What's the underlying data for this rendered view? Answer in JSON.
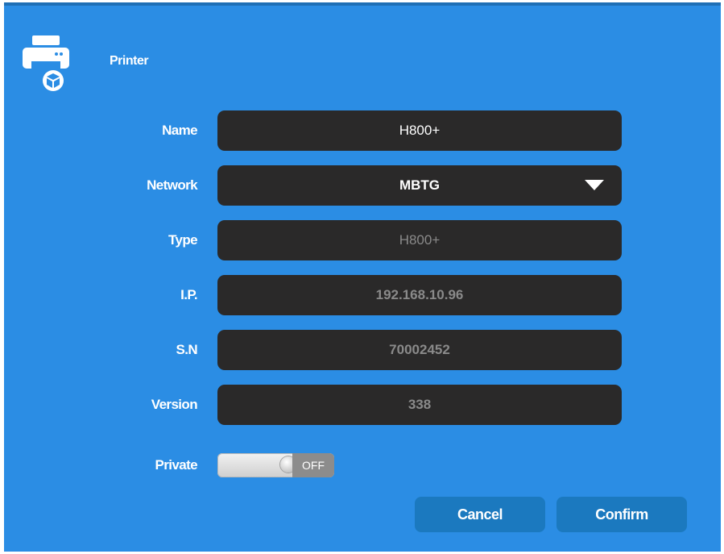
{
  "header": {
    "title": "Printer",
    "icon": "printer-icon"
  },
  "fields": {
    "name": {
      "label": "Name",
      "value": "H800+"
    },
    "network": {
      "label": "Network",
      "value": "MBTG",
      "icon": "dropdown-arrow-icon"
    },
    "type": {
      "label": "Type",
      "value": "H800+"
    },
    "ip": {
      "label": "I.P.",
      "value": "192.168.10.96"
    },
    "sn": {
      "label": "S.N",
      "value": "70002452"
    },
    "version": {
      "label": "Version",
      "value": "338"
    }
  },
  "private": {
    "label": "Private",
    "state": "OFF"
  },
  "buttons": {
    "cancel": "Cancel",
    "confirm": "Confirm"
  },
  "colors": {
    "background": "#2b8de4",
    "field": "#2a2929",
    "button": "#1b79bf",
    "readonly_text": "#8a8a8a"
  }
}
